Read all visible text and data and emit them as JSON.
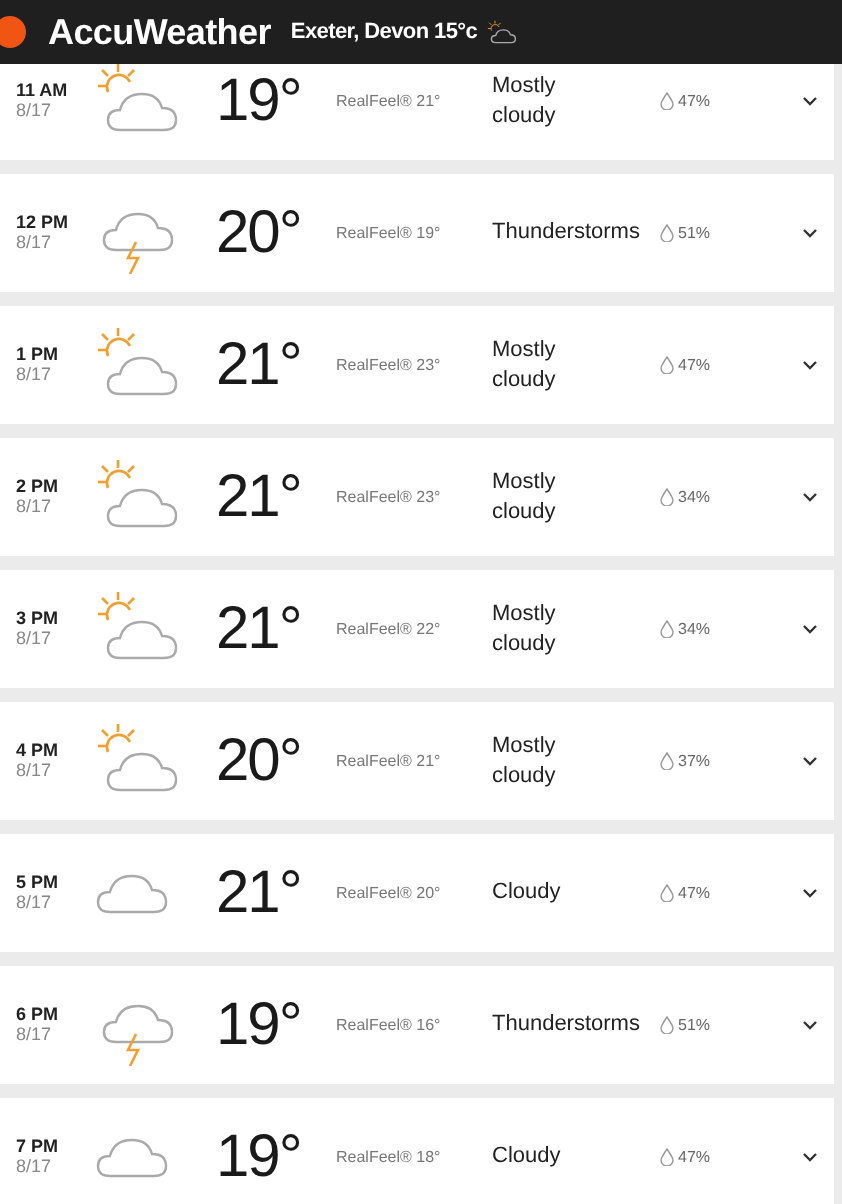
{
  "header": {
    "brand": "AccuWeather",
    "location": "Exeter, Devon",
    "temperature": "15°c"
  },
  "hours": [
    {
      "time": "11 AM",
      "date": "8/17",
      "kind": "partly-cloudy",
      "temp": "19°",
      "realfeel": "RealFeel® 21°",
      "phrase": "Mostly cloudy",
      "precip": "47%"
    },
    {
      "time": "12 PM",
      "date": "8/17",
      "kind": "thunderstorm",
      "temp": "20°",
      "realfeel": "RealFeel® 19°",
      "phrase": "Thunderstorms",
      "precip": "51%"
    },
    {
      "time": "1 PM",
      "date": "8/17",
      "kind": "partly-cloudy",
      "temp": "21°",
      "realfeel": "RealFeel® 23°",
      "phrase": "Mostly cloudy",
      "precip": "47%"
    },
    {
      "time": "2 PM",
      "date": "8/17",
      "kind": "partly-cloudy",
      "temp": "21°",
      "realfeel": "RealFeel® 23°",
      "phrase": "Mostly cloudy",
      "precip": "34%"
    },
    {
      "time": "3 PM",
      "date": "8/17",
      "kind": "partly-cloudy",
      "temp": "21°",
      "realfeel": "RealFeel® 22°",
      "phrase": "Mostly cloudy",
      "precip": "34%"
    },
    {
      "time": "4 PM",
      "date": "8/17",
      "kind": "partly-cloudy",
      "temp": "20°",
      "realfeel": "RealFeel® 21°",
      "phrase": "Mostly cloudy",
      "precip": "37%"
    },
    {
      "time": "5 PM",
      "date": "8/17",
      "kind": "cloudy",
      "temp": "21°",
      "realfeel": "RealFeel® 20°",
      "phrase": "Cloudy",
      "precip": "47%"
    },
    {
      "time": "6 PM",
      "date": "8/17",
      "kind": "thunderstorm",
      "temp": "19°",
      "realfeel": "RealFeel® 16°",
      "phrase": "Thunderstorms",
      "precip": "51%"
    },
    {
      "time": "7 PM",
      "date": "8/17",
      "kind": "cloudy",
      "temp": "19°",
      "realfeel": "RealFeel® 18°",
      "phrase": "Cloudy",
      "precip": "47%"
    }
  ]
}
